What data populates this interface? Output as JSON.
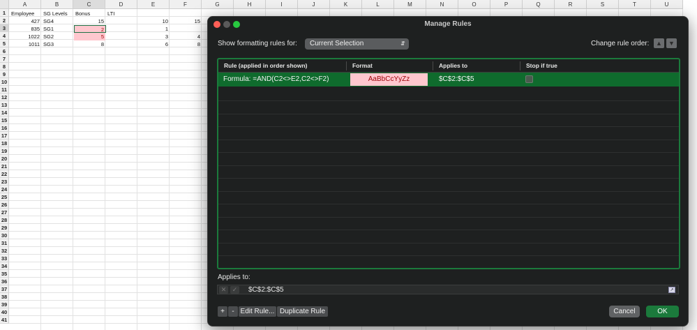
{
  "sheet": {
    "columns": [
      "A",
      "B",
      "C",
      "D",
      "E",
      "F",
      "G",
      "H",
      "I",
      "J",
      "K",
      "L",
      "M",
      "N",
      "O",
      "P",
      "Q",
      "R",
      "S",
      "T",
      "U"
    ],
    "rows": [
      "1",
      "2",
      "3",
      "4",
      "5",
      "6",
      "7",
      "8",
      "9",
      "10",
      "11",
      "12",
      "13",
      "14",
      "15",
      "16",
      "17",
      "18",
      "19",
      "20",
      "21",
      "22",
      "23",
      "24",
      "25",
      "26",
      "27",
      "28",
      "29",
      "30",
      "31",
      "32",
      "33",
      "34",
      "35",
      "36",
      "37",
      "38",
      "39",
      "40",
      "41"
    ],
    "headers": {
      "a": "Employee",
      "b": "SG Levels",
      "c": "Bonus",
      "d": "LTI"
    },
    "data": [
      {
        "a": "427",
        "b": "SG4",
        "c": "15",
        "e": "10",
        "f": "15"
      },
      {
        "a": "835",
        "b": "SG1",
        "c": "2",
        "e": "1",
        "f": ""
      },
      {
        "a": "1022",
        "b": "SG2",
        "c": "5",
        "e": "3",
        "f": "4"
      },
      {
        "a": "1011",
        "b": "SG3",
        "c": "8",
        "e": "6",
        "f": "8"
      }
    ],
    "highlight_color": "#ffc7ce",
    "highlight_text_color": "#9c0006"
  },
  "dialog": {
    "title": "Manage Rules",
    "show_rules_label": "Show formatting rules for:",
    "scope_value": "Current Selection",
    "change_order_label": "Change rule order:",
    "columns": {
      "rule": "Rule (applied in order shown)",
      "format": "Format",
      "applies_to": "Applies to",
      "stop_if_true": "Stop if true"
    },
    "rules": [
      {
        "rule": "Formula: =AND(C2<>E2,C2<>F2)",
        "format_preview": "AaBbCcYyZz",
        "applies_to": "$C$2:$C$5",
        "stop_if_true": false
      }
    ],
    "applies_to_label": "Applies to:",
    "applies_to_value": "$C$2:$C$5",
    "buttons": {
      "add": "+",
      "remove": "-",
      "edit": "Edit Rule...",
      "duplicate": "Duplicate Rule",
      "cancel": "Cancel",
      "ok": "OK"
    },
    "accent_color": "#1b7a3c"
  }
}
